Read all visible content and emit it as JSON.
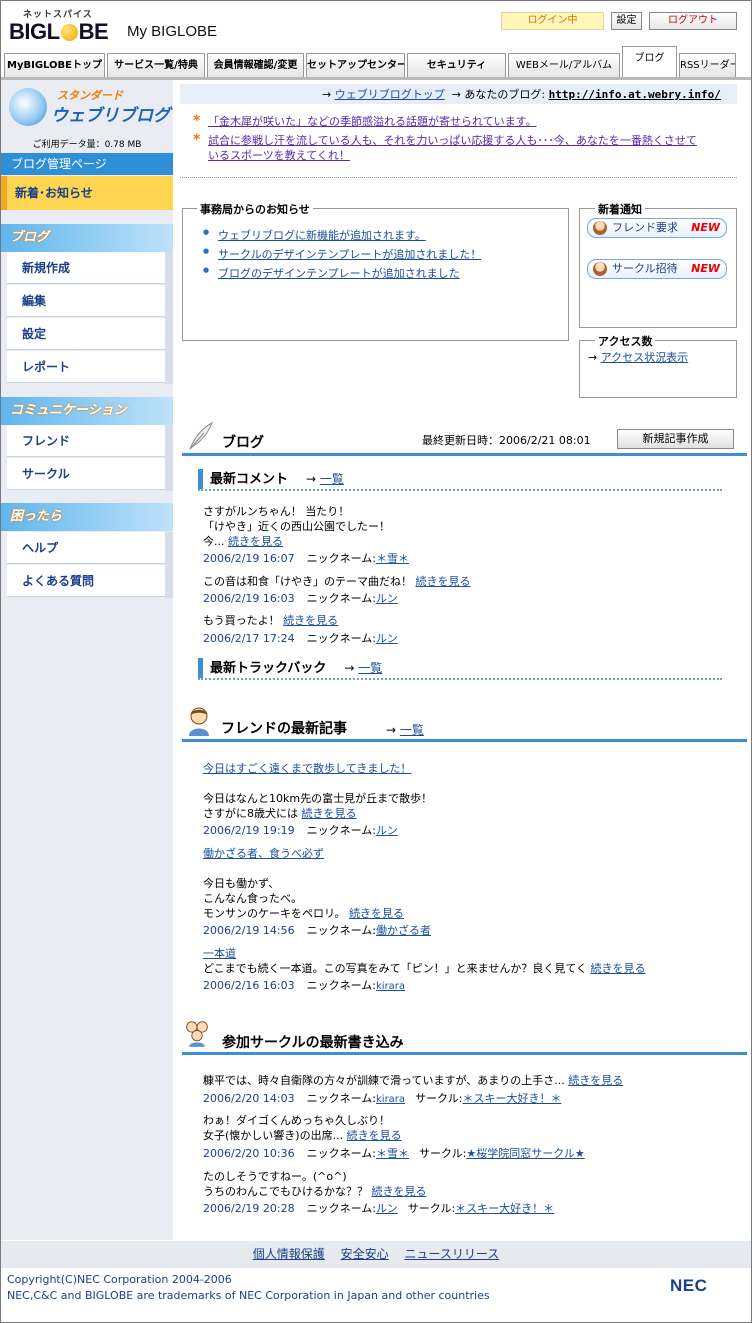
{
  "header": {
    "logo_tagline": "ネットスパイス",
    "logo_text_pre": "BIGL",
    "logo_text_post": "BE",
    "my_label": "My BIGLOBE",
    "login_status": "ログイン中",
    "settings_label": "設定",
    "logout_label": "ログアウト",
    "tabs": [
      {
        "label": "MyBIGLOBEトップ"
      },
      {
        "label": "サービス一覧/特典"
      },
      {
        "label": "会員情報確認/変更"
      },
      {
        "label": "セットアップセンター"
      },
      {
        "label": "セキュリティ"
      },
      {
        "label": "WEBメール/アルバム"
      },
      {
        "label": "ブログ",
        "active": true
      },
      {
        "label": "RSSリーダー"
      }
    ]
  },
  "sidebar": {
    "logo_top": "スタンダード",
    "logo_main": "ウェブリブログ",
    "usage": "ご利用データ量：0.78 MB",
    "manage_label": "ブログ管理ページ",
    "highlight_label": "新着･お知らせ",
    "sections": [
      {
        "title": "ブログ",
        "items": [
          "新規作成",
          "編集",
          "設定",
          "レポート"
        ]
      },
      {
        "title": "コミュニケーション",
        "items": [
          "フレンド",
          "サークル"
        ]
      },
      {
        "title": "困ったら",
        "items": [
          "ヘルプ",
          "よくある質問"
        ]
      }
    ]
  },
  "topbar": {
    "arrow": "→",
    "top_link": "ウェブリブログトップ",
    "your_blog_label": "→ あなたのブログ:",
    "blog_url": "http://info.at.webry.info/"
  },
  "news": [
    {
      "text": "「金木犀が咲いた」などの季節感溢れる話題が寄せられています。"
    },
    {
      "text": "試合に参戦し汗を流している人も、それを力いっぱい応援する人も･･･今、あなたを一番熱くさせているスポーツを教えてくれ！",
      "line1": "試合に参戦し汗を流している人も、それを力いっぱい応援する人も･･･今、あなたを一番熱くさせて",
      "line2": "いるスポーツを教えてくれ！"
    }
  ],
  "notice": {
    "title": "事務局からのお知らせ",
    "items": [
      "ウェブリブログに新機能が追加されます。",
      "サークルのデザインテンプレートが追加されました！",
      "ブログのデザインテンプレートが追加されました"
    ]
  },
  "arrivals": {
    "title": "新着通知",
    "friend_request": "フレンド要求",
    "circle_invite": "サークル招待",
    "new_badge": "NEW"
  },
  "access": {
    "title": "アクセス数",
    "link": "アクセス状況表示"
  },
  "blog": {
    "title": "ブログ",
    "last_updated": "最終更新日時：2006/2/21 08:01",
    "new_post_button": "新規記事作成",
    "latest_comments_title": "最新コメント",
    "list_link": "一覧",
    "comments": [
      {
        "lines": [
          "さすがルンちゃん！ 当たり！",
          "「けやき」近くの西山公園でしたー！",
          "今..."
        ],
        "more": "続きを見る",
        "date": "2006/2/19 16:07",
        "nick_label": "ニックネーム:",
        "nick": "＊雪＊"
      },
      {
        "lines": [
          "この音は和食「けやき」のテーマ曲だね！"
        ],
        "more": "続きを見る",
        "date": "2006/2/19 16:03",
        "nick_label": "ニックネーム:",
        "nick": "ルン"
      },
      {
        "lines": [
          "もう買ったよ！"
        ],
        "more": "続きを見る",
        "date": "2006/2/17 17:24",
        "nick_label": "ニックネーム:",
        "nick": "ルン"
      }
    ],
    "trackback_title": "最新トラックバック"
  },
  "friends": {
    "title": "フレンドの最新記事",
    "list_link": "一覧",
    "posts": [
      {
        "title": "今日はすごく遠くまで散歩してきました！",
        "lines": [
          "今日はなんと10km先の富士見が丘まで散歩！",
          "さすがに8歳犬には"
        ],
        "more": "続きを見る",
        "date": "2006/2/19 19:19",
        "nick_label": "ニックネーム:",
        "nick": "ルン"
      },
      {
        "title": "働かざる者、食うべ必ず",
        "lines": [
          "今日も働かず、",
          "こんなん食ったべ。",
          "モンサンのケーキをペロリ。"
        ],
        "more": "続きを見る",
        "date": "2006/2/19 14:56",
        "nick_label": "ニックネーム:",
        "nick": "働かざる者"
      },
      {
        "title": "一本道",
        "lines": [
          "どこまでも続く一本道。この写真をみて「ピン！」と来ませんか？良く見てく"
        ],
        "more": "続きを見る",
        "date": "2006/2/16 16:03",
        "nick_label": "ニックネーム:",
        "nick": "kirara"
      }
    ]
  },
  "circles": {
    "title": "参加サークルの最新書き込み",
    "posts": [
      {
        "lines": [
          "糠平では、時々自衛隊の方々が訓練で滑っていますが、あまりの上手さ..."
        ],
        "more": "続きを見る",
        "date": "2006/2/20 14:03",
        "nick_label": "ニックネーム:",
        "nick": "kirara",
        "circle_label": "サークル:",
        "circle": "＊スキー大好き！＊"
      },
      {
        "lines": [
          "わぁ！ダイゴくんめっちゃ久しぶり！",
          "女子(懐かしい響き)の出席..."
        ],
        "more": "続きを見る",
        "date": "2006/2/20 10:36",
        "nick_label": "ニックネーム:",
        "nick": "＊雪＊",
        "circle_label": "サークル:",
        "circle": "★桜学院同窓サークル★"
      },
      {
        "lines": [
          "たのしそうですねー。(^o^)",
          "うちのわんこでもひけるかな？？"
        ],
        "more": "続きを見る",
        "date": "2006/2/19 20:28",
        "nick_label": "ニックネーム:",
        "nick": "ルン",
        "circle_label": "サークル:",
        "circle": "＊スキー大好き！＊"
      }
    ]
  },
  "footer": {
    "links": [
      "個人情報保護",
      "安全安心",
      "ニュースリリース"
    ],
    "copyright": "Copyright(C)NEC Corporation 2004-2006",
    "trademark": "NEC,C&C and BIGLOBE are trademarks of NEC Corporation in Japan and other countries",
    "nec_logo": "NEC"
  },
  "colors": {
    "accent_blue": "#3d8fd4",
    "highlight_yellow": "#ffd450",
    "new_red": "#e00000",
    "star_orange": "#f07a00"
  }
}
